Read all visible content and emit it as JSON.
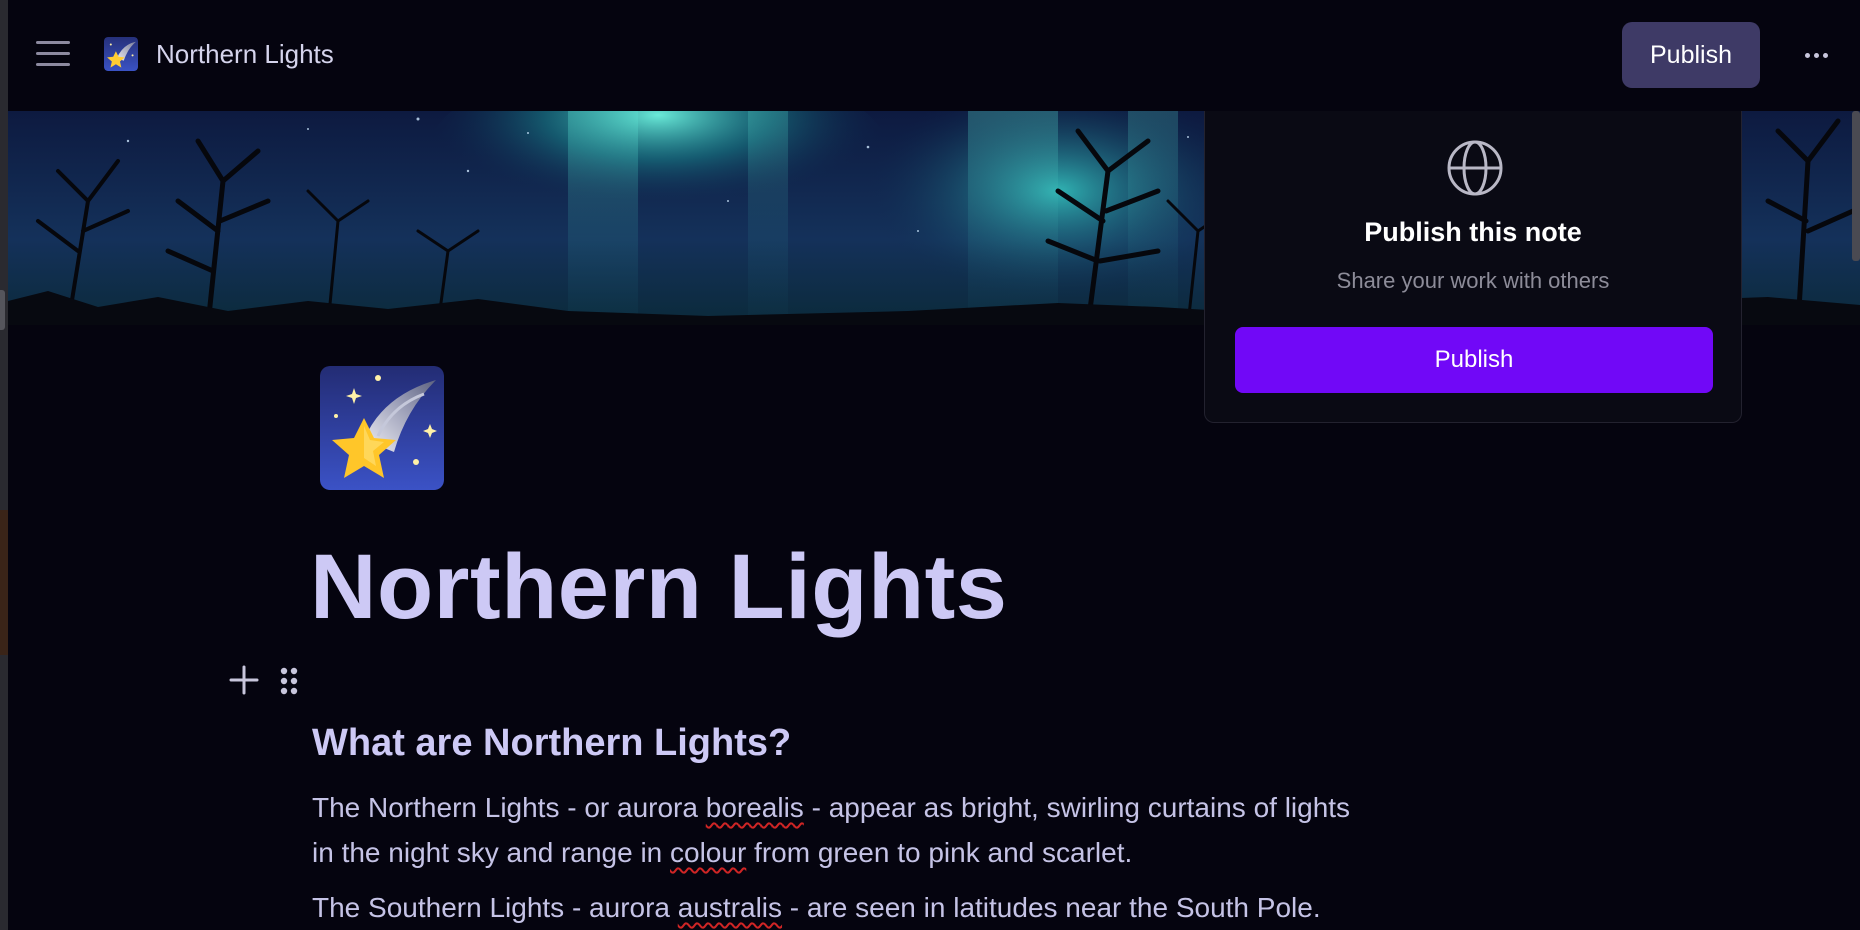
{
  "header": {
    "menu_icon": "hamburger-menu-icon",
    "page_icon": "shooting-star-emoji",
    "title": "Northern Lights",
    "publish_label": "Publish",
    "more_icon": "more-horizontal-icon"
  },
  "popover": {
    "icon": "globe-icon",
    "title": "Publish this note",
    "subtitle": "Share your work with others",
    "publish_label": "Publish"
  },
  "page": {
    "icon": "shooting-star-emoji",
    "title": "Northern Lights",
    "heading": "What are Northern Lights?",
    "paragraph1": {
      "line1_before": "The Northern Lights - or aurora ",
      "line1_misspelled": "borealis",
      "line1_after": " - appear as bright, swirling curtains of lights",
      "line2_before": "in the night sky and range in ",
      "line2_misspelled": "colour",
      "line2_after": " from green to pink and scarlet."
    },
    "paragraph2": {
      "before": "The Southern Lights - aurora ",
      "misspelled": "australis",
      "after": " - are seen in latitudes near the South Pole."
    }
  },
  "colors": {
    "background": "#05040f",
    "title": "#cdc9f5",
    "primary_button": "#7108f7",
    "header_button": "#3e3a66"
  }
}
